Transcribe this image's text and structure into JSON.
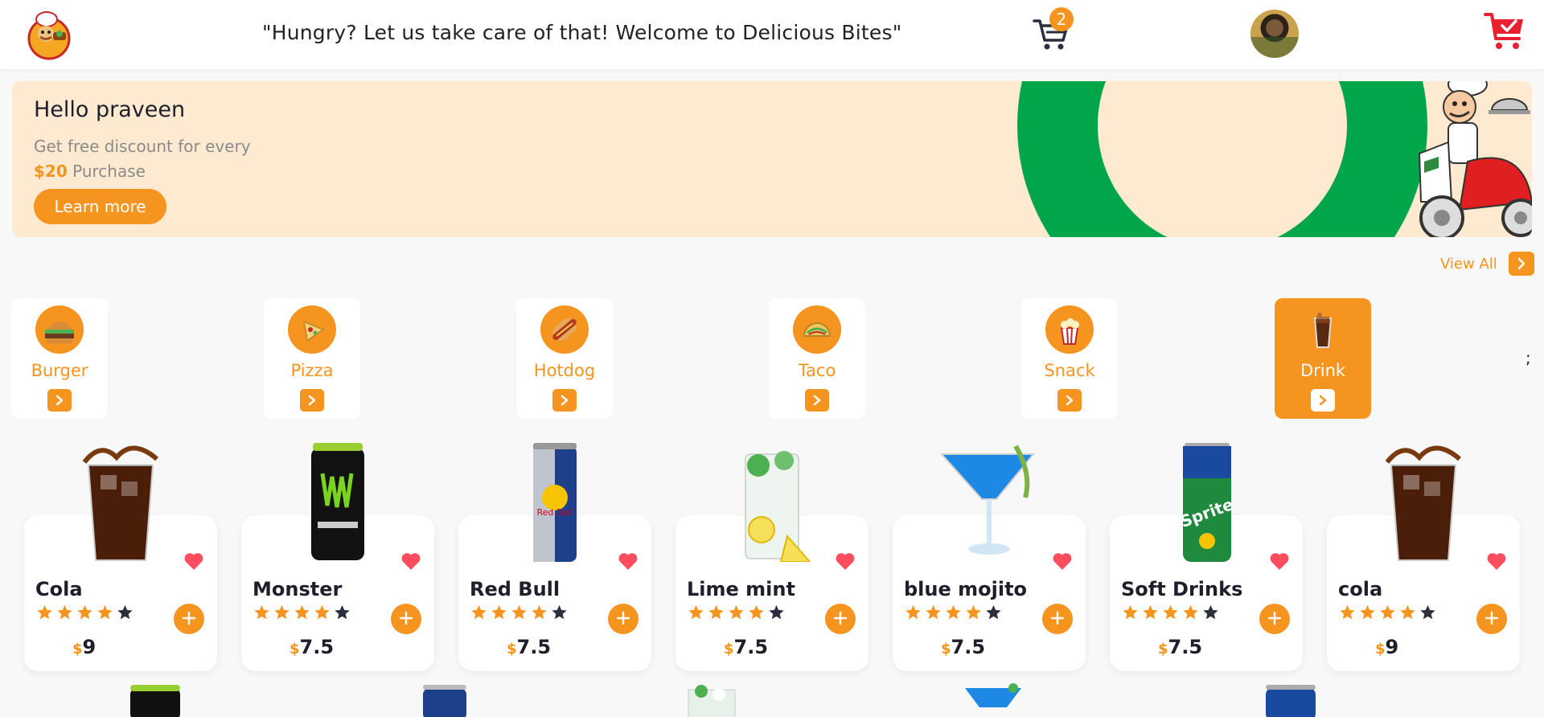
{
  "header": {
    "tagline": "\"Hungry? Let us take care of that! Welcome to Delicious Bites\"",
    "cart_count": "2",
    "logo_icon": "chef-logo-icon",
    "cart_icon": "shopping-cart-icon",
    "order_icon": "cart-check-icon"
  },
  "banner": {
    "greeting": "Hello praveen",
    "line1": "Get free discount for every",
    "amount": "$20",
    "line2": " Purchase",
    "button": "Learn more"
  },
  "view_all": "View All",
  "stray_char": ";",
  "categories": [
    {
      "label": "Burger",
      "active": false
    },
    {
      "label": "Pizza",
      "active": false
    },
    {
      "label": "Hotdog",
      "active": false
    },
    {
      "label": "Taco",
      "active": false
    },
    {
      "label": "Snack",
      "active": false
    },
    {
      "label": "Drink",
      "active": true
    }
  ],
  "products": [
    {
      "name": "Cola",
      "currency": "$",
      "price": "9",
      "rating": 4
    },
    {
      "name": "Monster",
      "currency": "$",
      "price": "7.5",
      "rating": 4
    },
    {
      "name": "Red Bull",
      "currency": "$",
      "price": "7.5",
      "rating": 4
    },
    {
      "name": "Lime mint",
      "currency": "$",
      "price": "7.5",
      "rating": 4
    },
    {
      "name": "blue mojito",
      "currency": "$",
      "price": "7.5",
      "rating": 4
    },
    {
      "name": "Soft Drinks",
      "currency": "$",
      "price": "7.5",
      "rating": 4
    },
    {
      "name": "cola",
      "currency": "$",
      "price": "9",
      "rating": 4
    }
  ],
  "colors": {
    "accent": "#f5941e",
    "banner": "#feead0",
    "ring": "#01a54a",
    "heart": "#ff4d5e",
    "star_empty": "#2d2f3d"
  }
}
